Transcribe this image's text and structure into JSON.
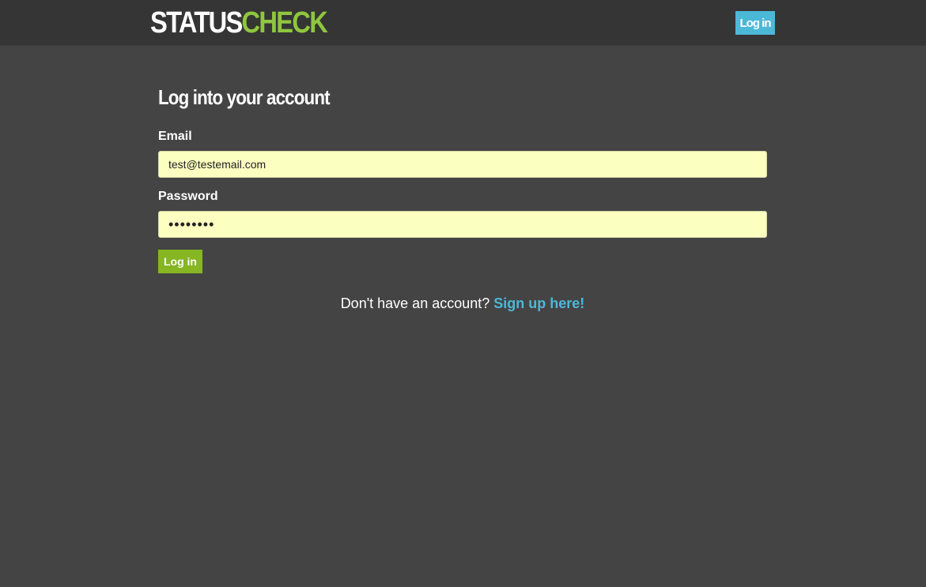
{
  "header": {
    "logo_part1": "STATUS",
    "logo_part2": "CHECK",
    "login_label": "Log in"
  },
  "form": {
    "title": "Log into your account",
    "email_label": "Email",
    "email_value": "test@testemail.com",
    "password_label": "Password",
    "password_value": "••••••••",
    "submit_label": "Log in"
  },
  "signup": {
    "prompt": "Don't have an account?",
    "link_label": "Sign up here!"
  },
  "colors": {
    "background": "#444444",
    "header_background": "#353535",
    "brand_green": "#8fc63f",
    "accent_blue": "#4cb8d8",
    "button_green": "#86b621",
    "input_background": "#fbffc0"
  }
}
